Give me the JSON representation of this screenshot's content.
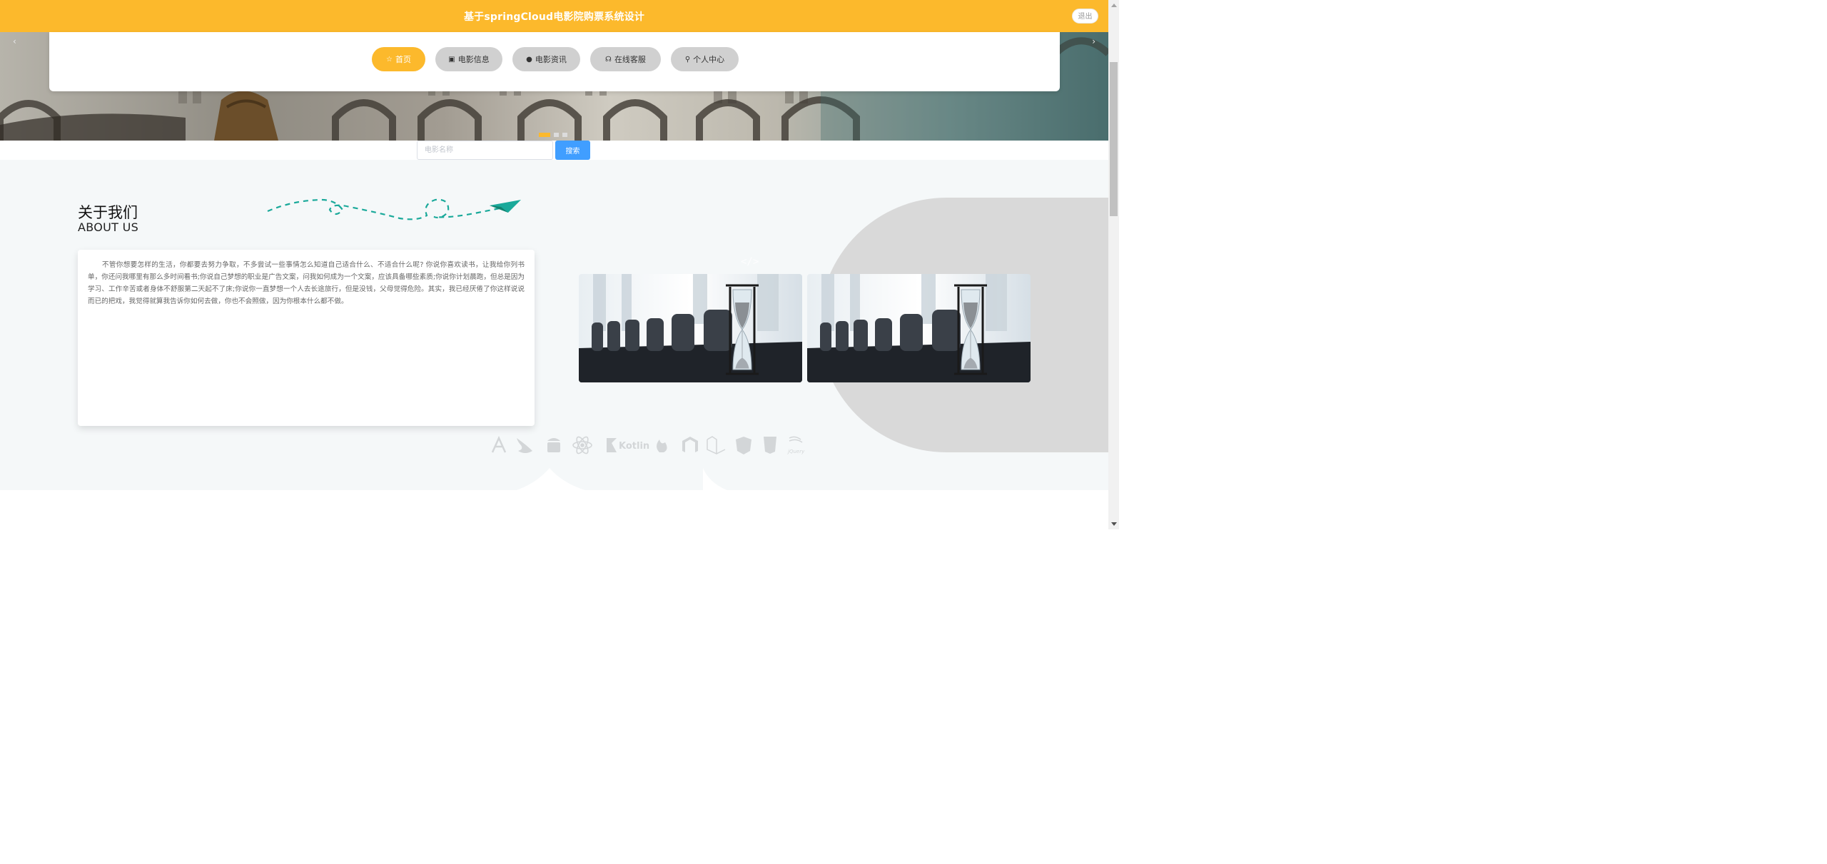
{
  "header": {
    "title": "基于springCloud电影院购票系统设计",
    "logout_label": "退出",
    "bg_color": "#fcb92c"
  },
  "banner": {
    "prev_label": "‹",
    "next_label": "›",
    "slide_count": 3,
    "active_slide": 1
  },
  "nav": {
    "items": [
      {
        "label": "首页",
        "icon": "star-icon",
        "active": true
      },
      {
        "label": "电影信息",
        "icon": "bag-icon",
        "active": false
      },
      {
        "label": "电影资讯",
        "icon": "alert-circle-icon",
        "active": false
      },
      {
        "label": "在线客服",
        "icon": "headset-icon",
        "active": false
      },
      {
        "label": "个人中心",
        "icon": "user-icon",
        "active": false
      }
    ],
    "active_color": "#fcb92c",
    "inactive_color": "#d0d0d0"
  },
  "search": {
    "placeholder": "电影名称",
    "value": "",
    "button_label": "搜索",
    "button_color": "#409eff"
  },
  "about": {
    "title": "关于我们",
    "subtitle": "ABOUT US",
    "body": "不管你想要怎样的生活，你都要去努力争取，不多尝试一些事情怎么知道自己适合什么、不适合什么呢? 你说你喜欢读书，让我给你列书单，你还问我哪里有那么多时间看书;你说自己梦想的职业是广告文案，问我如何成为一个文案，应该具备哪些素质;你说你计划晨跑，但总是因为学习、工作辛苦或者身体不舒服第二天起不了床;你说你一直梦想一个人去长途旅行，但是没钱，父母觉得危险。其实，我已经厌倦了你这样说说而已的把戏，我觉得就算我告诉你如何去做，你也不会照做，因为你根本什么都不做。",
    "code_icon": "</>",
    "tech_logos": [
      "app-store-icon",
      "swift-icon",
      "android-icon",
      "react-icon",
      "Kotlin",
      "firebase-icon",
      "magento-icon",
      "laravel-icon",
      "angular-icon",
      "html5-icon",
      "jQuery"
    ]
  }
}
